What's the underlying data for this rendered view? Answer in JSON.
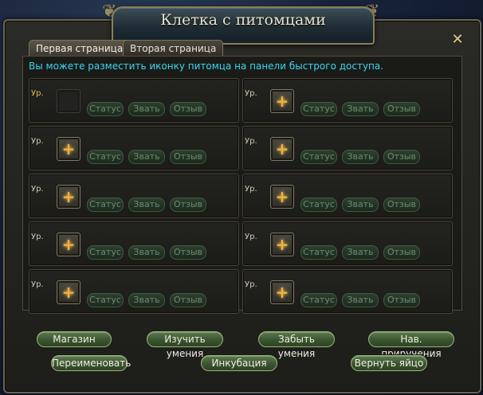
{
  "window": {
    "title": "Клетка с питомцами",
    "close_symbol": "✕"
  },
  "tabs": [
    {
      "label": "Первая страница",
      "active": true
    },
    {
      "label": "Вторая страница",
      "active": false
    }
  ],
  "info_text": "Вы можете разместить иконку питомца на панели быстрого доступа.",
  "slot_buttons": {
    "status": "Статус",
    "call": "Звать",
    "recall": "Отзыв"
  },
  "slots": [
    {
      "level_label": "Ур.",
      "icon": "empty-slot",
      "highlighted": true
    },
    {
      "level_label": "Ур.",
      "icon": "add-pet-icon"
    },
    {
      "level_label": "Ур.",
      "icon": "add-pet-icon"
    },
    {
      "level_label": "Ур.",
      "icon": "add-pet-icon"
    },
    {
      "level_label": "Ур.",
      "icon": "add-pet-icon"
    },
    {
      "level_label": "Ур.",
      "icon": "add-pet-icon"
    },
    {
      "level_label": "Ур.",
      "icon": "add-pet-icon"
    },
    {
      "level_label": "Ур.",
      "icon": "add-pet-icon"
    },
    {
      "level_label": "Ур.",
      "icon": "add-pet-icon"
    },
    {
      "level_label": "Ур.",
      "icon": "add-pet-icon"
    }
  ],
  "add_icon_symbol": "+",
  "bottom_buttons": {
    "shop": "Магазин",
    "learn_skills": "Изучить умения",
    "forget_skills": "Забыть умения",
    "taming_skill": "Нав. приручения",
    "rename": "Переименовать",
    "incubation": "Инкубация",
    "return_egg": "Вернуть яйцо"
  },
  "colors": {
    "info_text": "#39d8f0",
    "accent_gold": "#e3b94b",
    "button_green": "#3a5530"
  }
}
